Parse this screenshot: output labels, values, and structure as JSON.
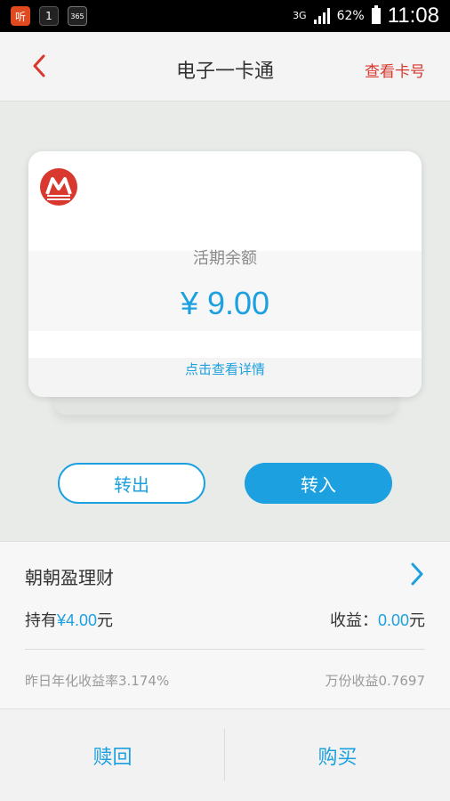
{
  "status_bar": {
    "app1": "听",
    "app2": "1",
    "app3": "365",
    "network": "3G",
    "battery": "62%",
    "time": "11:08"
  },
  "header": {
    "title": "电子一卡通",
    "action": "查看卡号"
  },
  "card": {
    "balance_label": "活期余额",
    "balance_amount": "¥ 9.00",
    "detail_link": "点击查看详情"
  },
  "buttons": {
    "transfer_out": "转出",
    "transfer_in": "转入"
  },
  "product": {
    "title": "朝朝盈理财",
    "hold_label": "持有",
    "hold_value": "¥4.00",
    "hold_unit": "元",
    "income_label": "收益：",
    "income_value": "0.00",
    "income_unit": "元",
    "annual_rate": "昨日年化收益率3.174%",
    "wanfen": "万份收益0.7697"
  },
  "bottom": {
    "redeem": "赎回",
    "buy": "购买"
  },
  "colors": {
    "accent": "#1ca0e0",
    "brand_red": "#d9382e"
  }
}
